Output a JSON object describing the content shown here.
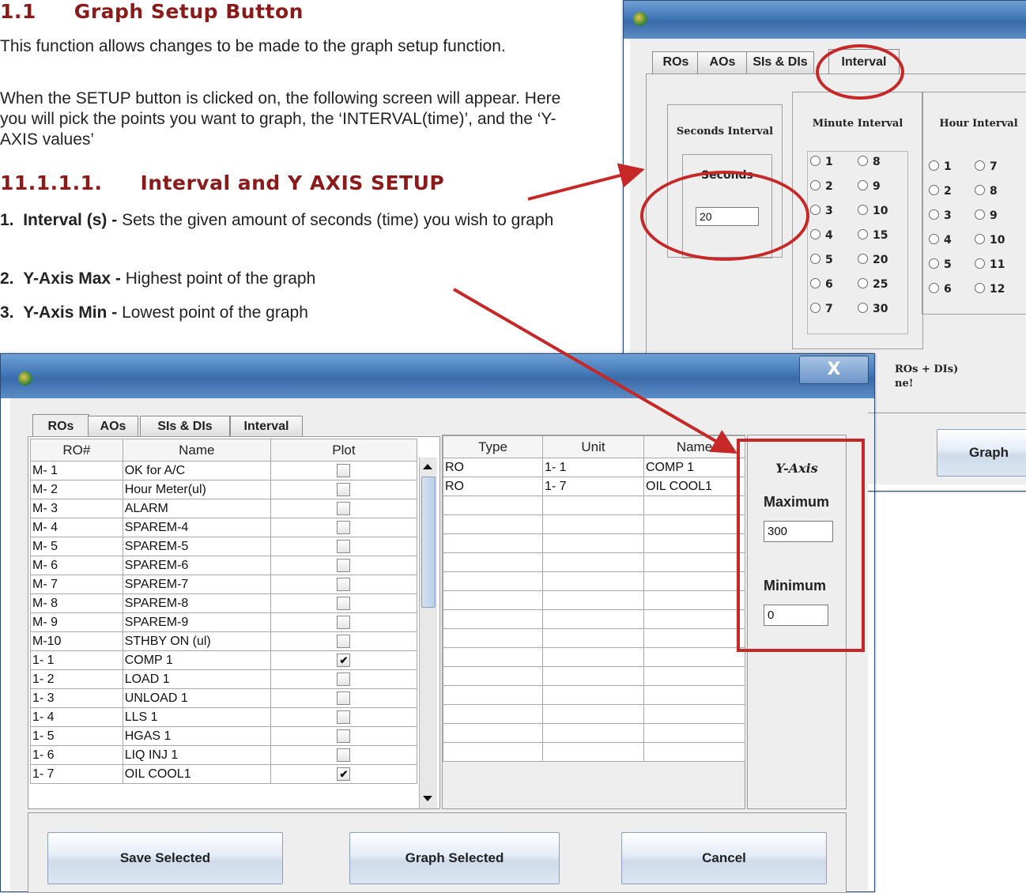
{
  "doc": {
    "heading": {
      "number": "1.1",
      "title": "Graph Setup Button"
    },
    "para1": "This function allows changes to be made to the graph setup function.",
    "para2": "When the SETUP button is clicked on, the following screen will appear. Here you will pick the points you want to graph, the ‘INTERVAL(time)’, and the ‘Y-AXIS values’",
    "subheading": {
      "number": "11.1.1.1.",
      "title": "Interval and Y AXIS SETUP"
    },
    "list": [
      {
        "num": "1.",
        "term": "Interval (s) -",
        "desc": "Sets the given amount of seconds (time) you wish to graph"
      },
      {
        "num": "2.",
        "term": "Y-Axis Max -",
        "desc": "Highest point of the graph"
      },
      {
        "num": "3.",
        "term": "Y-Axis Min -",
        "desc": "Lowest point of the graph"
      }
    ]
  },
  "back_window": {
    "tabs": [
      "ROs",
      "AOs",
      "SIs & DIs",
      "Interval"
    ],
    "seconds_interval": {
      "title": "Seconds Interval",
      "label": "Seconds",
      "value": "20"
    },
    "minute_interval": {
      "title": "Minute Interval",
      "col1": [
        "1",
        "2",
        "3",
        "4",
        "5",
        "6",
        "7"
      ],
      "col2": [
        "8",
        "9",
        "10",
        "15",
        "20",
        "25",
        "30"
      ]
    },
    "hour_interval": {
      "title": "Hour Interval",
      "col1": [
        "1",
        "2",
        "3",
        "4",
        "5",
        "6"
      ],
      "col2": [
        "7",
        "8",
        "9",
        "10",
        "11",
        "12"
      ]
    },
    "note_line1": "ROs + DIs)",
    "note_line2": "ne!",
    "graph_button": "Graph"
  },
  "front_window": {
    "close_label": "X",
    "tabs": [
      "ROs",
      "AOs",
      "SIs & DIs",
      "Interval"
    ],
    "points_table": {
      "headers": [
        "RO#",
        "Name",
        "Plot"
      ],
      "rows": [
        {
          "num": "M- 1",
          "name": "OK for A/C",
          "plot": ""
        },
        {
          "num": "M- 2",
          "name": "Hour Meter(ul)",
          "plot": ""
        },
        {
          "num": "M- 3",
          "name": "ALARM",
          "plot": ""
        },
        {
          "num": "M- 4",
          "name": "SPAREM-4",
          "plot": ""
        },
        {
          "num": "M- 5",
          "name": "SPAREM-5",
          "plot": ""
        },
        {
          "num": "M- 6",
          "name": "SPAREM-6",
          "plot": ""
        },
        {
          "num": "M- 7",
          "name": "SPAREM-7",
          "plot": ""
        },
        {
          "num": "M- 8",
          "name": "SPAREM-8",
          "plot": ""
        },
        {
          "num": "M- 9",
          "name": "SPAREM-9",
          "plot": ""
        },
        {
          "num": "M-10",
          "name": "STHBY ON  (ul)",
          "plot": ""
        },
        {
          "num": "1- 1",
          "name": "COMP 1",
          "plot": "✔"
        },
        {
          "num": "1- 2",
          "name": "LOAD 1",
          "plot": ""
        },
        {
          "num": "1- 3",
          "name": "UNLOAD 1",
          "plot": ""
        },
        {
          "num": "1- 4",
          "name": "LLS 1",
          "plot": ""
        },
        {
          "num": "1- 5",
          "name": "HGAS 1",
          "plot": ""
        },
        {
          "num": "1- 6",
          "name": "LIQ INJ 1",
          "plot": ""
        },
        {
          "num": "1- 7",
          "name": "OIL COOL1",
          "plot": "✔"
        }
      ]
    },
    "selected_table": {
      "headers": [
        "Type",
        "Unit",
        "Name"
      ],
      "rows": [
        {
          "type": "RO",
          "unit": "1- 1",
          "name": "COMP 1"
        },
        {
          "type": "RO",
          "unit": "1- 7",
          "name": "OIL COOL1"
        }
      ]
    },
    "y_axis": {
      "title": "Y-Axis",
      "max_label": "Maximum",
      "max_value": "300",
      "min_label": "Minimum",
      "min_value": "0"
    },
    "buttons": {
      "save": "Save Selected",
      "graph": "Graph Selected",
      "cancel": "Cancel"
    }
  }
}
